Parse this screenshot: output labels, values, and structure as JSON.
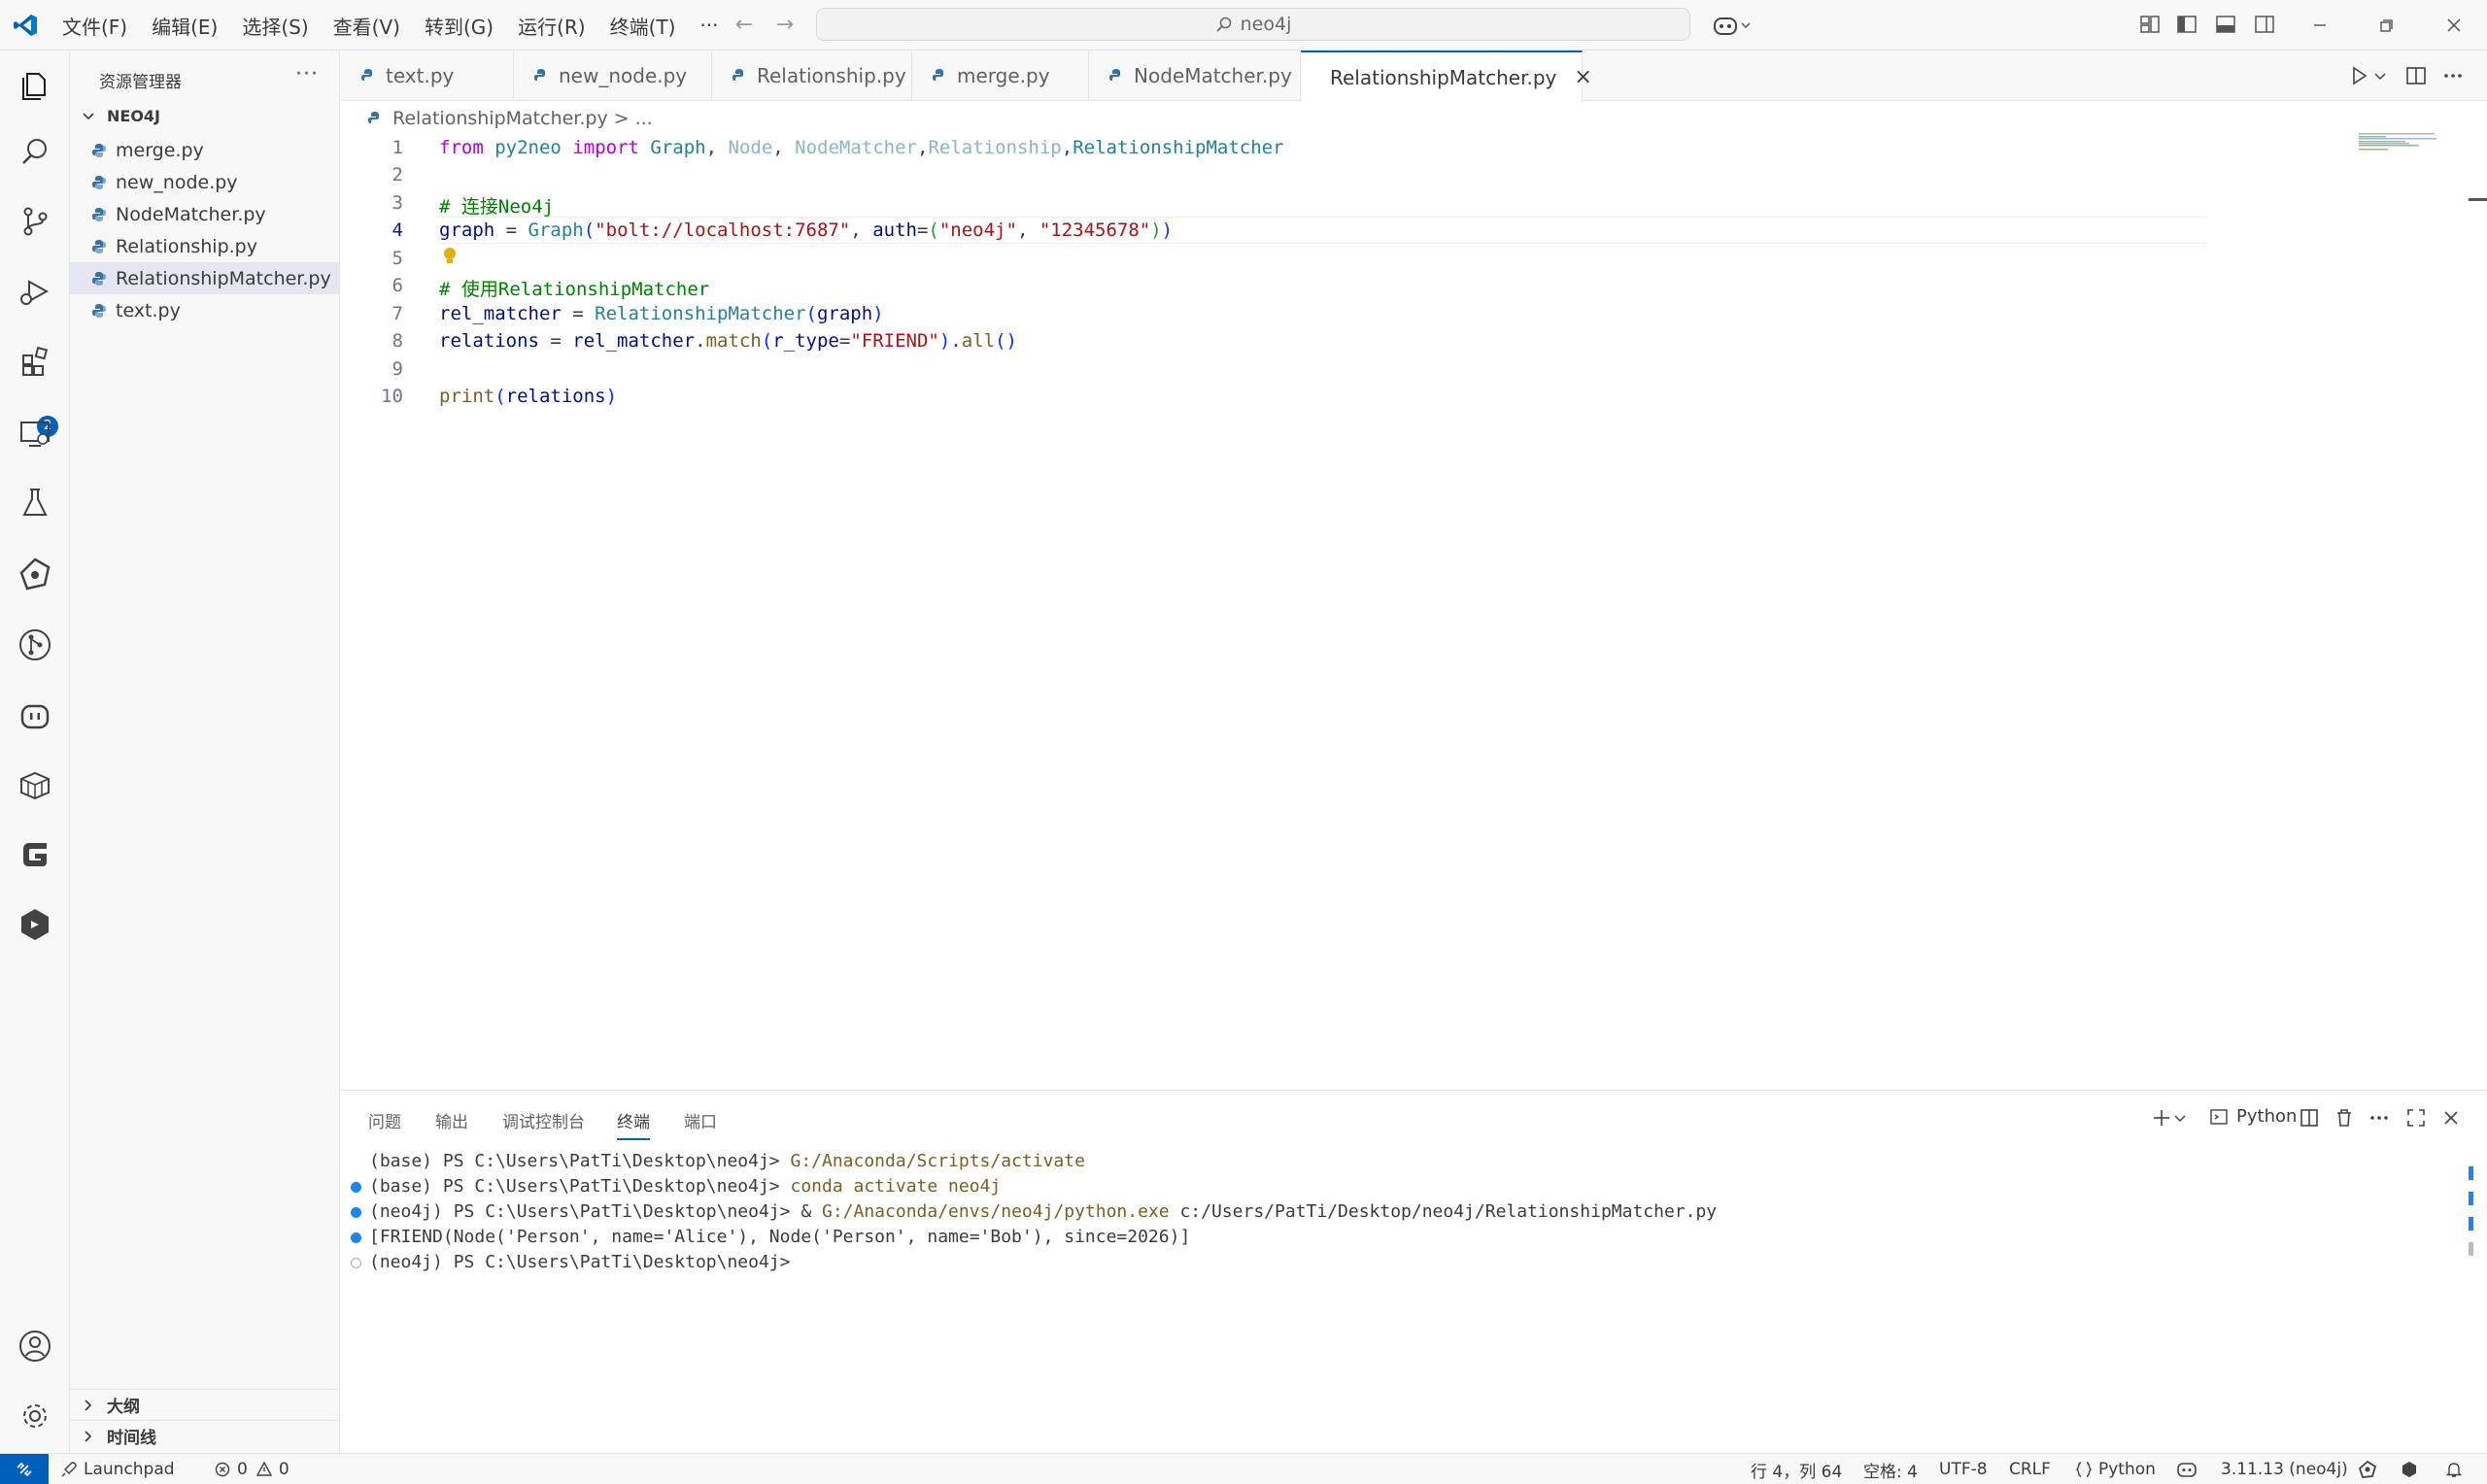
{
  "menu": [
    "文件(F)",
    "编辑(E)",
    "选择(S)",
    "查看(V)",
    "转到(G)",
    "运行(R)",
    "终端(T)",
    "···"
  ],
  "search": {
    "text": "neo4j"
  },
  "sidebar": {
    "title": "资源管理器",
    "more": "···",
    "folder": "NEO4J",
    "files": [
      "merge.py",
      "new_node.py",
      "NodeMatcher.py",
      "Relationship.py",
      "RelationshipMatcher.py",
      "text.py"
    ],
    "selected": "RelationshipMatcher.py",
    "outline": "大纲",
    "timeline": "时间线"
  },
  "activity": {
    "extensions_badge": "2"
  },
  "tabs": [
    "text.py",
    "new_node.py",
    "Relationship.py",
    "merge.py",
    "NodeMatcher.py",
    "RelationshipMatcher.py"
  ],
  "active_tab": "RelationshipMatcher.py",
  "breadcrumb": {
    "file": "RelationshipMatcher.py",
    "sep": ">",
    "rest": "..."
  },
  "editor": {
    "line_numbers": [
      "1",
      "2",
      "3",
      "4",
      "5",
      "6",
      "7",
      "8",
      "9",
      "10"
    ],
    "current_line": "4",
    "lines": {
      "l1": {
        "kw1": "from",
        "mod": "py2neo",
        "kw2": "import",
        "c1": "Graph",
        "c2": "Node",
        "c3": "NodeMatcher",
        "c4": "Relationship",
        "c5": "RelationshipMatcher"
      },
      "l3": {
        "hash": "#",
        "text": "连接Neo4j"
      },
      "l4": {
        "var": "graph",
        "cls": "Graph",
        "s1": "\"bolt://localhost:7687\"",
        "p": "auth",
        "s2": "\"neo4j\"",
        "s3": "\"12345678\""
      },
      "l6": {
        "hash": "#",
        "text": "使用RelationshipMatcher"
      },
      "l7": {
        "var": "rel_matcher",
        "cls": "RelationshipMatcher",
        "arg": "graph"
      },
      "l8": {
        "var": "relations",
        "obj": "rel_matcher",
        "fn1": "match",
        "p": "r_type",
        "s": "\"FRIEND\"",
        "fn2": "all"
      },
      "l10": {
        "fn": "print",
        "arg": "relations"
      }
    }
  },
  "panel": {
    "tabs": [
      "问题",
      "输出",
      "调试控制台",
      "终端",
      "端口"
    ],
    "active": "终端",
    "python_label": "Python",
    "terminal": [
      {
        "prompt": "(base) PS C:\\Users\\PatTi\\Desktop\\neo4j> ",
        "cmd": "G:/Anaconda/Scripts/activate",
        "dot": "none"
      },
      {
        "prompt": "(base) PS C:\\Users\\PatTi\\Desktop\\neo4j> ",
        "cmd": "conda activate neo4j",
        "dot": "filled"
      },
      {
        "prompt": "(neo4j) PS C:\\Users\\PatTi\\Desktop\\neo4j> & ",
        "cmd": "G:/Anaconda/envs/neo4j/python.exe",
        "rest": " c:/Users/PatTi/Desktop/neo4j/RelationshipMatcher.py",
        "dot": "filled"
      },
      {
        "prompt": "[FRIEND(Node('Person', name='Alice'), Node('Person', name='Bob'), since=2026)]",
        "dot": "filled"
      },
      {
        "prompt": "(neo4j) PS C:\\Users\\PatTi\\Desktop\\neo4j>",
        "dot": "empty"
      }
    ]
  },
  "status": {
    "launchpad": "Launchpad",
    "errors": "0",
    "warnings": "0",
    "position": "行 4，列 64",
    "spaces": "空格: 4",
    "encoding": "UTF-8",
    "eol": "CRLF",
    "language": "Python",
    "interpreter": "3.11.13 (neo4j)"
  },
  "colors": {
    "accent": "#005fb8",
    "keyword": "#af00db",
    "type": "#267f99",
    "string": "#a31515",
    "comment": "#008000"
  }
}
